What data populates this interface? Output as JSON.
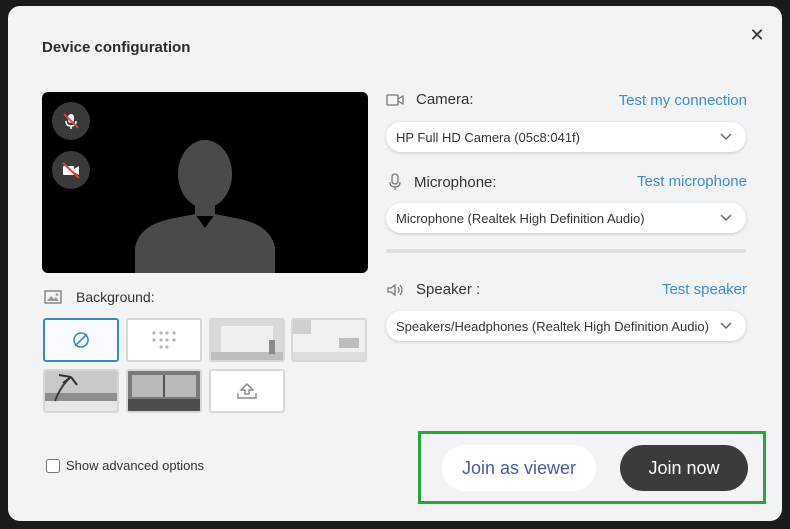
{
  "dialog": {
    "title": "Device configuration",
    "close_glyph": "✕"
  },
  "preview": {
    "mic_icon": "mic-muted-icon",
    "camera_icon": "camera-off-icon"
  },
  "background": {
    "label": "Background:",
    "thumbnails": [
      "none",
      "blur",
      "room",
      "office",
      "beach",
      "city-window",
      "upload"
    ]
  },
  "advanced": {
    "label": "Show advanced options",
    "checked": false
  },
  "camera": {
    "label": "Camera:",
    "link": "Test my connection",
    "selected": "HP Full HD Camera (05c8:041f)"
  },
  "microphone": {
    "label": "Microphone:",
    "link": "Test microphone",
    "selected": "Microphone (Realtek High Definition Audio)"
  },
  "speaker": {
    "label": "Speaker :",
    "link": "Test speaker",
    "selected": "Speakers/Headphones (Realtek High Definition Audio)"
  },
  "actions": {
    "join_viewer": "Join as viewer",
    "join_now": "Join now"
  },
  "colors": {
    "link": "#3b8ed0",
    "primary_button": "#3b3b3b",
    "highlight_box": "#2aa53a",
    "selected_thumb": "#3a87c8"
  }
}
